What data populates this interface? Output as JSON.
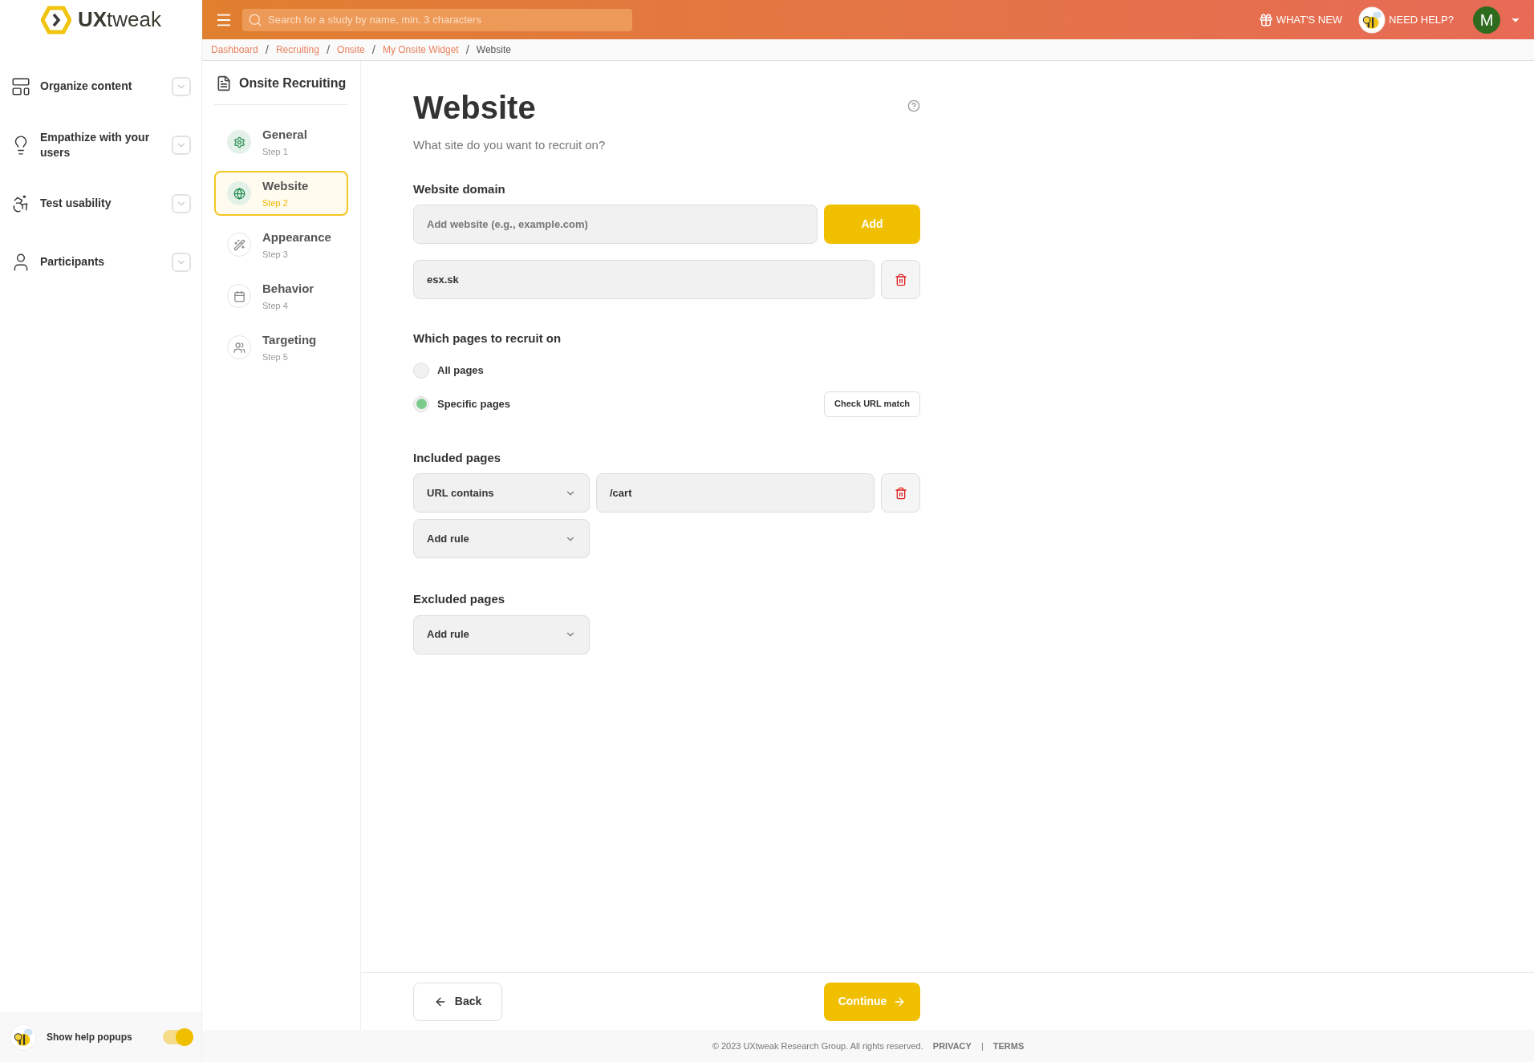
{
  "header": {
    "logo": "**UX**tweak",
    "search": {
      "placeholder": "Search for a study by name, min. 3 characters"
    },
    "whats_new": "WHAT'S NEW",
    "need_help": "NEED HELP?",
    "avatar": "M"
  },
  "breadcrumbs": [
    {
      "label": "Dashboard",
      "current": false
    },
    {
      "label": "Recruiting",
      "current": false
    },
    {
      "label": "Onsite",
      "current": false
    },
    {
      "label": "My Onsite Widget",
      "current": false
    },
    {
      "label": "Website",
      "current": true
    }
  ],
  "breadcrumb_separator": "/",
  "sidebar": {
    "items": [
      {
        "label": "Organize content",
        "expanded": false
      },
      {
        "label": "Empathize with your users",
        "expanded": false
      },
      {
        "label": "Test usability",
        "expanded": false
      },
      {
        "label": "Participants",
        "expanded": false
      }
    ],
    "help_toggle": {
      "label": "Show help popups",
      "on": true
    }
  },
  "steps": {
    "title": "Onsite Recruiting",
    "items": [
      {
        "title": "General",
        "subtitle": "Step 1",
        "selected": false,
        "completed": true
      },
      {
        "title": "Website",
        "subtitle": "Step 2",
        "selected": true,
        "completed": true
      },
      {
        "title": "Appearance",
        "subtitle": "Step 3",
        "selected": false,
        "completed": false
      },
      {
        "title": "Behavior",
        "subtitle": "Step 4",
        "selected": false,
        "completed": false
      },
      {
        "title": "Targeting",
        "subtitle": "Step 5",
        "selected": false,
        "completed": false
      }
    ]
  },
  "main": {
    "title": "Website",
    "subtitle": "What site do you want to recruit on?",
    "domain": {
      "label": "Website domain",
      "placeholder": "Add website (e.g., example.com)",
      "add_button": "Add",
      "entries": [
        {
          "value": "esx.sk"
        }
      ]
    },
    "pages": {
      "label": "Which pages to recruit on",
      "options": [
        {
          "label": "All pages",
          "selected": false
        },
        {
          "label": "Specific pages",
          "selected": true
        }
      ],
      "check_button": "Check URL match"
    },
    "included": {
      "label": "Included pages",
      "rules": [
        {
          "operator": "URL contains",
          "value": "/cart"
        }
      ],
      "add_rule": "Add rule"
    },
    "excluded": {
      "label": "Excluded pages",
      "add_rule": "Add rule"
    }
  },
  "footer": {
    "back": "Back",
    "continue": "Continue",
    "copyright": "© 2023 UXtweak Research Group. All rights reserved.",
    "links": [
      "PRIVACY",
      "TERMS"
    ],
    "separator": "|"
  }
}
